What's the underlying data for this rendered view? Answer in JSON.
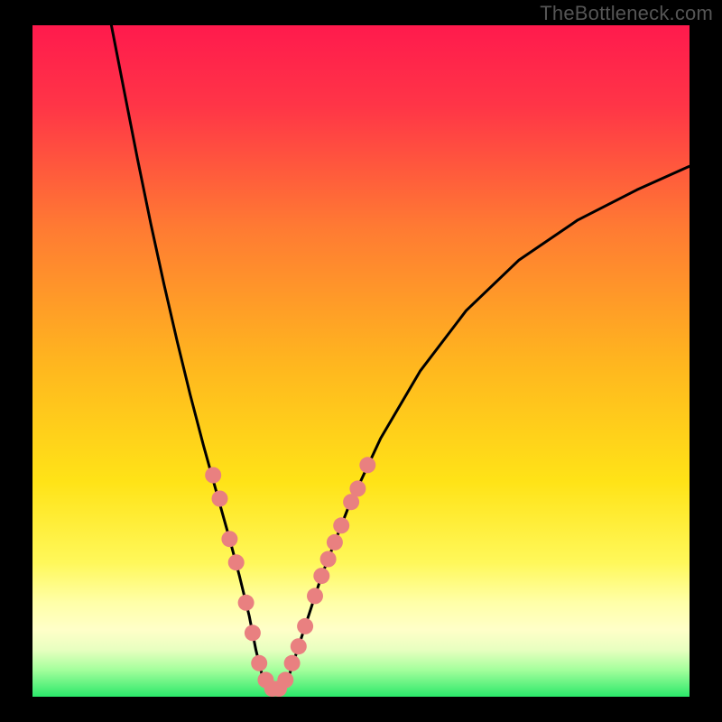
{
  "watermark": "TheBottleneck.com",
  "colors": {
    "top": "#ff1a4d",
    "mid": "#ffd400",
    "lowPale": "#ffffb0",
    "bottom": "#2be86a",
    "curve": "#000000",
    "dot": "#e98080",
    "frame": "#000000"
  },
  "chart_data": {
    "type": "line",
    "title": "",
    "xlabel": "",
    "ylabel": "",
    "xlim": [
      0,
      100
    ],
    "ylim": [
      0,
      100
    ],
    "grid": false,
    "legend": false,
    "series": [
      {
        "name": "curve-left",
        "x": [
          12.0,
          14.0,
          16.0,
          18.0,
          20.0,
          22.0,
          24.0,
          26.0,
          28.0,
          30.0,
          31.5,
          33.0,
          34.0,
          35.0
        ],
        "y": [
          100.0,
          90.0,
          80.0,
          70.5,
          61.5,
          53.0,
          45.0,
          37.5,
          30.5,
          23.5,
          18.0,
          12.0,
          7.0,
          3.0
        ]
      },
      {
        "name": "curve-floor",
        "x": [
          35.0,
          36.0,
          37.0,
          38.0,
          39.0
        ],
        "y": [
          3.0,
          1.5,
          1.0,
          1.5,
          3.0
        ]
      },
      {
        "name": "curve-right",
        "x": [
          39.0,
          41.0,
          44.0,
          48.0,
          53.0,
          59.0,
          66.0,
          74.0,
          83.0,
          92.0,
          100.0
        ],
        "y": [
          3.0,
          9.0,
          18.0,
          28.0,
          38.5,
          48.5,
          57.5,
          65.0,
          71.0,
          75.5,
          79.0
        ]
      }
    ],
    "dots": [
      {
        "x": 27.5,
        "y": 33.0
      },
      {
        "x": 28.5,
        "y": 29.5
      },
      {
        "x": 30.0,
        "y": 23.5
      },
      {
        "x": 31.0,
        "y": 20.0
      },
      {
        "x": 32.5,
        "y": 14.0
      },
      {
        "x": 33.5,
        "y": 9.5
      },
      {
        "x": 34.5,
        "y": 5.0
      },
      {
        "x": 35.5,
        "y": 2.5
      },
      {
        "x": 36.5,
        "y": 1.2
      },
      {
        "x": 37.5,
        "y": 1.2
      },
      {
        "x": 38.5,
        "y": 2.5
      },
      {
        "x": 39.5,
        "y": 5.0
      },
      {
        "x": 40.5,
        "y": 7.5
      },
      {
        "x": 41.5,
        "y": 10.5
      },
      {
        "x": 43.0,
        "y": 15.0
      },
      {
        "x": 44.0,
        "y": 18.0
      },
      {
        "x": 45.0,
        "y": 20.5
      },
      {
        "x": 46.0,
        "y": 23.0
      },
      {
        "x": 47.0,
        "y": 25.5
      },
      {
        "x": 48.5,
        "y": 29.0
      },
      {
        "x": 49.5,
        "y": 31.0
      },
      {
        "x": 51.0,
        "y": 34.5
      }
    ]
  }
}
